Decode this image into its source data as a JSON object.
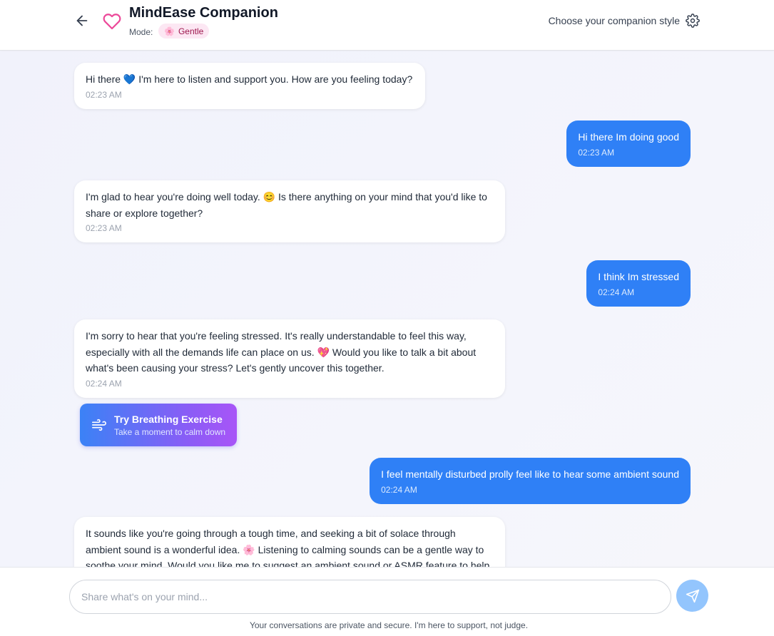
{
  "header": {
    "title": "MindEase Companion",
    "mode_label": "Mode:",
    "mode_value": "Gentle",
    "mode_icon": "🌸",
    "companion_style": "Choose your companion style"
  },
  "messages": [
    {
      "role": "bot",
      "text": "Hi there 💙 I'm here to listen and support you. How are you feeling today?",
      "time": "02:23 AM"
    },
    {
      "role": "user",
      "text": "Hi there Im doing good",
      "time": "02:23 AM"
    },
    {
      "role": "bot",
      "text": "I'm glad to hear you're doing well today. 😊 Is there anything on your mind that you'd like to share or explore together?",
      "time": "02:23 AM"
    },
    {
      "role": "user",
      "text": "I think Im stressed",
      "time": "02:24 AM"
    },
    {
      "role": "bot",
      "text": "I'm sorry to hear that you're feeling stressed. It's really understandable to feel this way, especially with all the demands life can place on us. 💖 Would you like to talk a bit about what's been causing your stress? Let's gently uncover this together.",
      "time": "02:24 AM"
    },
    {
      "role": "user",
      "text": "I feel mentally disturbed prolly feel like to hear some ambient sound",
      "time": "02:24 AM"
    },
    {
      "role": "bot",
      "text": "It sounds like you're going through a tough time, and seeking a bit of solace through ambient sound is a wonderful idea. 🌸 Listening to calming sounds can be a gentle way to soothe your mind. Would you like me to suggest an ambient sound or ASMR feature to help you",
      "time": ""
    }
  ],
  "breathing": {
    "title": "Try Breathing Exercise",
    "subtitle": "Take a moment to calm down"
  },
  "composer": {
    "placeholder": "Share what's on your mind...",
    "value": ""
  },
  "footer": {
    "disclaimer": "Your conversations are private and secure. I'm here to support, not judge."
  },
  "colors": {
    "accent": "#2f80f6",
    "brand_pink": "#ec4899",
    "badge_bg": "#fce7f3",
    "send_button": "#93c5fd"
  },
  "icons": {
    "back": "arrow-left-icon",
    "brand": "heart-icon",
    "settings": "gear-icon",
    "breathing": "wind-icon",
    "send": "send-icon"
  }
}
